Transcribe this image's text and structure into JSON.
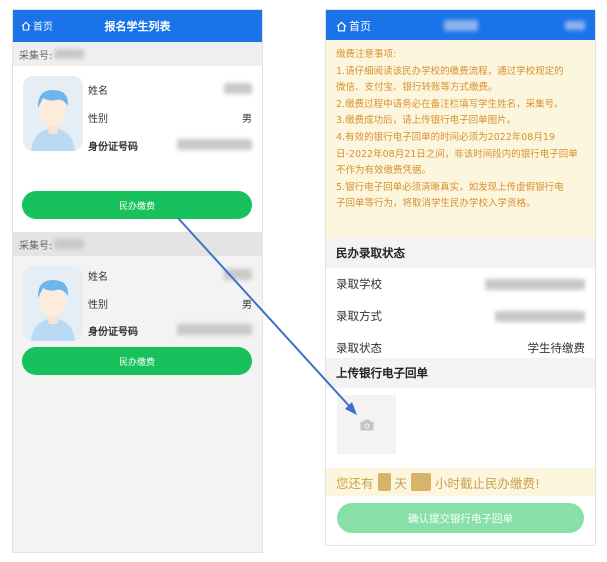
{
  "left_screen": {
    "home_label": "首页",
    "title": "报名学生列表",
    "students": [
      {
        "collect_label": "采集号:",
        "name_label": "姓名",
        "gender_label": "性别",
        "gender_value": "男",
        "id_label": "身份证号码",
        "pay_button": "民办缴费"
      },
      {
        "collect_label": "采集号:",
        "name_label": "姓名",
        "gender_label": "性别",
        "gender_value": "男",
        "id_label": "身份证号码",
        "pay_button": "民办缴费"
      }
    ]
  },
  "right_screen": {
    "home_label": "首页",
    "notice": {
      "heading": "缴费注意事项:",
      "lines": [
        "1.请仔细阅读该民办学校的缴费流程，通过学校规定的",
        "微信、支付宝、银行转账等方式缴费。",
        "2.缴费过程中请务必在备注栏填写学生姓名，采集号。",
        "3.缴费成功后，请上传银行电子回单图片。",
        "4.有效的银行电子回单的时间必须为2022年08月19",
        "日-2022年08月21日之间，非该时间段内的银行电子回单",
        "不作为有效缴费凭据。",
        "5.银行电子回单必须清晰真实，如发现上传虚假银行电",
        "子回单等行为，将取消学生民办学校入学资格。"
      ]
    },
    "status_section": {
      "title": "民办录取状态",
      "school_label": "录取学校",
      "method_label": "录取方式",
      "status_label": "录取状态",
      "status_value": "学生待缴费"
    },
    "upload_section": {
      "title": "上传银行电子回单"
    },
    "countdown": {
      "prefix": "您还有",
      "days_unit": "天",
      "hours_suffix": "小时截止民办缴费!"
    },
    "submit_button": "确认提交银行电子回单"
  },
  "colors": {
    "header_blue": "#1a73e8",
    "pay_green": "#17c15c",
    "submit_green_disabled": "#86e0a8",
    "notice_bg": "#fdf6de",
    "notice_text": "#d7902e",
    "arrow": "#3f6fc9"
  },
  "icons": {
    "home": "home-icon",
    "camera": "camera-icon",
    "avatar": "student-avatar-icon"
  }
}
